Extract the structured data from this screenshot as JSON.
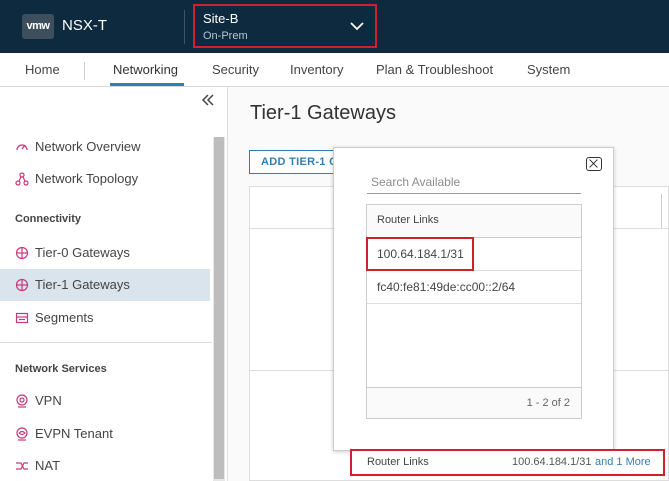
{
  "header": {
    "logo_text": "vmw",
    "app_title": "NSX-T",
    "site": {
      "name": "Site-B",
      "subtitle": "On-Prem"
    }
  },
  "nav": {
    "tabs": [
      {
        "label": "Home"
      },
      {
        "label": "Networking",
        "active": true
      },
      {
        "label": "Security"
      },
      {
        "label": "Inventory"
      },
      {
        "label": "Plan & Troubleshoot"
      },
      {
        "label": "System"
      }
    ]
  },
  "sidebar": {
    "items": [
      {
        "label": "Network Overview",
        "icon": "gauge-icon"
      },
      {
        "label": "Network Topology",
        "icon": "topology-icon"
      }
    ],
    "connectivity_heading": "Connectivity",
    "connectivity": [
      {
        "label": "Tier-0 Gateways",
        "icon": "gateway-icon"
      },
      {
        "label": "Tier-1 Gateways",
        "icon": "gateway-icon",
        "active": true
      },
      {
        "label": "Segments",
        "icon": "segments-icon"
      }
    ],
    "services_heading": "Network Services",
    "services": [
      {
        "label": "VPN",
        "icon": "vpn-icon"
      },
      {
        "label": "EVPN Tenant",
        "icon": "evpn-icon"
      },
      {
        "label": "NAT",
        "icon": "nat-icon"
      }
    ]
  },
  "main": {
    "page_title": "Tier-1 Gateways",
    "add_button": "ADD TIER-1 GATEWAY"
  },
  "popup": {
    "search_placeholder": "Search Available",
    "column_header": "Router Links",
    "rows": [
      "100.64.184.1/31",
      "fc40:fe81:49de:cc00::2/64"
    ],
    "footer": "1 - 2 of 2"
  },
  "router_links_row": {
    "label": "Router Links",
    "value": "100.64.184.1/31",
    "more": "and 1 More"
  },
  "colors": {
    "header_bg": "#0d2a3f",
    "accent": "#2f7fb5",
    "highlight": "#d0202a",
    "active_item_bg": "#d9e4ec"
  }
}
